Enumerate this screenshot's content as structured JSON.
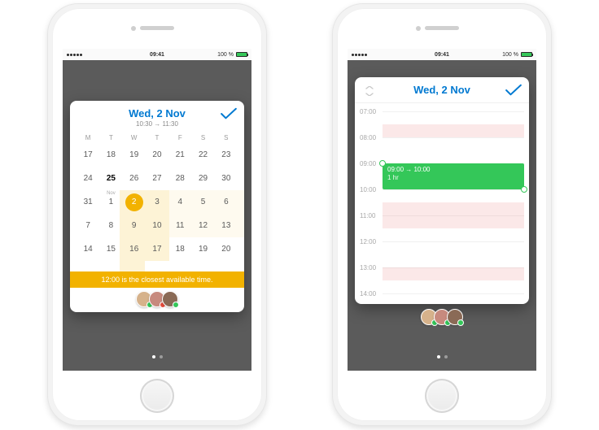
{
  "status": {
    "time": "09:41",
    "battery": "100 %"
  },
  "left": {
    "title": "Wed, 2 Nov",
    "subtitle": "10:30 → 11:30",
    "dow": [
      "M",
      "T",
      "W",
      "T",
      "F",
      "S",
      "S"
    ],
    "rows": [
      [
        "17",
        "18",
        "19",
        "20",
        "21",
        "22",
        "23"
      ],
      [
        "24",
        "25",
        "26",
        "27",
        "28",
        "29",
        "30"
      ],
      [
        "31",
        "1",
        "2",
        "3",
        "4",
        "5",
        "6"
      ],
      [
        "7",
        "8",
        "9",
        "10",
        "11",
        "12",
        "13"
      ],
      [
        "14",
        "15",
        "16",
        "17",
        "18",
        "19",
        "20"
      ],
      [
        "",
        "",
        "",
        "",
        "",
        "",
        ""
      ]
    ],
    "month_sublabel": "Nov",
    "month_sublabel_pos": {
      "row": 2,
      "col": 1
    },
    "today_pos": {
      "row": 1,
      "col": 1
    },
    "selected_pos": {
      "row": 2,
      "col": 2
    },
    "closest_text": "12:00 is the closest available time.",
    "avatars": [
      {
        "bg": "#d6b28b",
        "badge": "#34c759"
      },
      {
        "bg": "#c78a7e",
        "badge": "#e74c3c"
      },
      {
        "bg": "#8a6a56",
        "badge": "#34c759"
      }
    ]
  },
  "right": {
    "title": "Wed, 2 Nov",
    "hours": [
      "07:00",
      "08:00",
      "09:00",
      "10:00",
      "11:00",
      "12:00",
      "13:00",
      "14:00"
    ],
    "event": {
      "label": "09:00 → 10:00",
      "duration": "1 hr"
    },
    "avatars": [
      {
        "bg": "#d6b28b",
        "badge": "#34c759"
      },
      {
        "bg": "#c78a7e",
        "badge": "#34c759"
      },
      {
        "bg": "#8a6a56",
        "badge": "#34c759"
      }
    ]
  }
}
